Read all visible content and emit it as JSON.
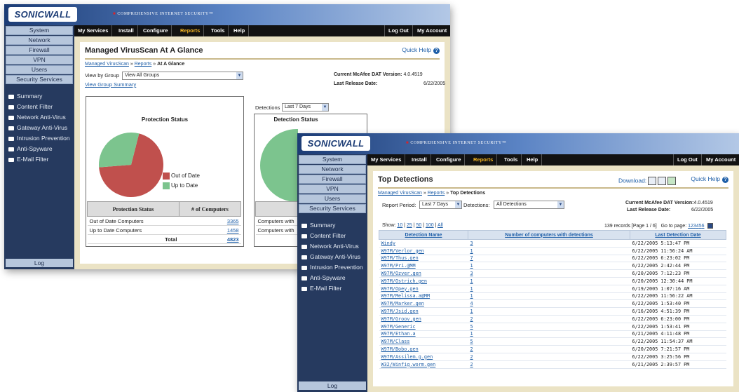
{
  "brand": {
    "logo": "SONICWALL",
    "tagline": "COMPREHENSIVE INTERNET SECURITY™"
  },
  "nav": {
    "buttons": [
      "System",
      "Network",
      "Firewall",
      "VPN",
      "Users",
      "Security Services"
    ],
    "items": [
      "Summary",
      "Content Filter",
      "Network Anti-Virus",
      "Gateway Anti-Virus",
      "Intrusion Prevention",
      "Anti-Spyware",
      "E-Mail Filter"
    ],
    "log": "Log"
  },
  "menu": {
    "left": [
      "My Services",
      "Install",
      "Configure",
      "Reports",
      "Tools",
      "Help"
    ],
    "right": [
      "Log Out",
      "My Account"
    ],
    "active": "Reports"
  },
  "quick_help": "Quick Help",
  "dat": {
    "version_label": "Current McAfee DAT Version:",
    "version_value": "4.0.4519",
    "release_label": "Last Release Date:",
    "release_value": "6/22/2005"
  },
  "glance": {
    "title": "Managed VirusScan At A Glance",
    "crumb_a": "Managed VirusScan",
    "crumb_sep": "»",
    "crumb_b": "Reports",
    "crumb_c": "At A Glance",
    "view_group_label": "View by Group",
    "view_group_value": "View All Groups",
    "view_group_summary": "View Group Summary",
    "detections_label": "Detections",
    "detections_value": "Last 7 Days",
    "protection_title": "Protection Status",
    "detection_title": "Detection Status",
    "legend": [
      {
        "label": "Out of Date",
        "color": "#c0504d"
      },
      {
        "label": "Up to Date",
        "color": "#7cc48e"
      }
    ],
    "table": {
      "headers": [
        "Protection Status",
        "# of Computers"
      ],
      "rows": [
        {
          "status": "Out of Date Computers",
          "count": "3365"
        },
        {
          "status": "Up to Date Computers",
          "count": "1458"
        }
      ],
      "total_label": "Total",
      "total_value": "4823"
    },
    "detect_table": {
      "header": "Detect",
      "rows": [
        "Computers with",
        "Computers with"
      ]
    }
  },
  "chart_data": {
    "type": "pie",
    "title": "Protection Status",
    "categories": [
      "Out of Date",
      "Up to Date"
    ],
    "values": [
      3365,
      1458
    ],
    "colors": [
      "#c0504d",
      "#7cc48e"
    ]
  },
  "top": {
    "title": "Top Detections",
    "download": "Download:",
    "crumb_a": "Managed VirusScan",
    "crumb_sep": "»",
    "crumb_b": "Reports",
    "crumb_c": "Top Detections",
    "period_label": "Report Period:",
    "period_value": "Last 7 Days",
    "detections_label": "Detections:",
    "detections_value": "All Detections",
    "show_label": "Show:",
    "show_options": [
      "10",
      "25",
      "50",
      "100",
      "All"
    ],
    "records": "139 records  [Page 1 / 6]",
    "goto_label": "Go to page:",
    "pages": [
      "1",
      "2",
      "3",
      "4",
      "5",
      "6"
    ],
    "headers": [
      "Detection Name",
      "Number of computers with detections",
      "Last Detection Date"
    ],
    "rows": [
      {
        "name": "Windy",
        "count": "3",
        "date": "6/22/2005 5:13:47 PM"
      },
      {
        "name": "W97M/Verlor.gen",
        "count": "1",
        "date": "6/22/2005 11:56:24 AM"
      },
      {
        "name": "W97M/Thus.gen",
        "count": "7",
        "date": "6/22/2005 6:23:02 PM"
      },
      {
        "name": "W97M/Pri.@MM",
        "count": "1",
        "date": "6/22/2005 2:42:44 PM"
      },
      {
        "name": "W97M/Ozver.gen",
        "count": "3",
        "date": "6/20/2005 7:12:23 PM"
      },
      {
        "name": "W97M/Ostrich.gen",
        "count": "1",
        "date": "6/20/2005 12:30:44 PM"
      },
      {
        "name": "W97M/Opey.gen",
        "count": "1",
        "date": "6/19/2005 1:07:16 AM"
      },
      {
        "name": "W97M/Melissa.a@MM",
        "count": "1",
        "date": "6/22/2005 11:56:22 AM"
      },
      {
        "name": "W97M/Marker.gen",
        "count": "4",
        "date": "6/22/2005 1:53:40 PM"
      },
      {
        "name": "W97M/Jsid.gen",
        "count": "1",
        "date": "6/16/2005 4:51:39 PM"
      },
      {
        "name": "W97M/Groov.gen",
        "count": "2",
        "date": "6/22/2005 6:23:00 PM"
      },
      {
        "name": "W97M/Generic",
        "count": "5",
        "date": "6/22/2005 1:53:41 PM"
      },
      {
        "name": "W97M/Ethan.a",
        "count": "1",
        "date": "6/21/2005 4:11:48 PM"
      },
      {
        "name": "W97M/Class",
        "count": "5",
        "date": "6/22/2005 11:54:37 AM"
      },
      {
        "name": "W97M/Bobo.gen",
        "count": "2",
        "date": "6/20/2005 7:21:57 PM"
      },
      {
        "name": "W97M/Assilem.g.gen",
        "count": "2",
        "date": "6/22/2005 3:25:56 PM"
      },
      {
        "name": "W32/Winfig.worm.gen",
        "count": "2",
        "date": "6/21/2005 2:39:57 PM"
      }
    ]
  }
}
